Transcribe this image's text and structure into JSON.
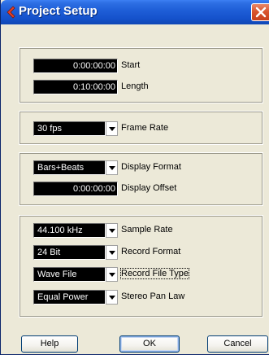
{
  "window": {
    "title": "Project Setup",
    "icon": "cubase-icon",
    "close": "close-icon"
  },
  "timing": {
    "start": {
      "value": "0:00:00:00",
      "label": "Start"
    },
    "length": {
      "value": "0:10:00:00",
      "label": "Length"
    }
  },
  "frame": {
    "rate": {
      "value": "30 fps",
      "label": "Frame Rate"
    }
  },
  "display": {
    "format": {
      "value": "Bars+Beats",
      "label": "Display Format"
    },
    "offset": {
      "value": "0:00:00:00",
      "label": "Display Offset"
    }
  },
  "audio": {
    "sample_rate": {
      "value": "44.100 kHz",
      "label": "Sample Rate"
    },
    "record_format": {
      "value": "24 Bit",
      "label": "Record Format"
    },
    "file_type": {
      "value": "Wave File",
      "label": "Record File Type"
    },
    "pan_law": {
      "value": "Equal Power",
      "label": "Stereo Pan Law"
    }
  },
  "buttons": {
    "help": "Help",
    "ok": "OK",
    "cancel": "Cancel"
  },
  "colors": {
    "titlebar": "#1f5fd8",
    "dialog_bg": "#ece9d8",
    "field_bg": "#000000",
    "field_text": "#ffffff",
    "close_button": "#d9552f"
  }
}
